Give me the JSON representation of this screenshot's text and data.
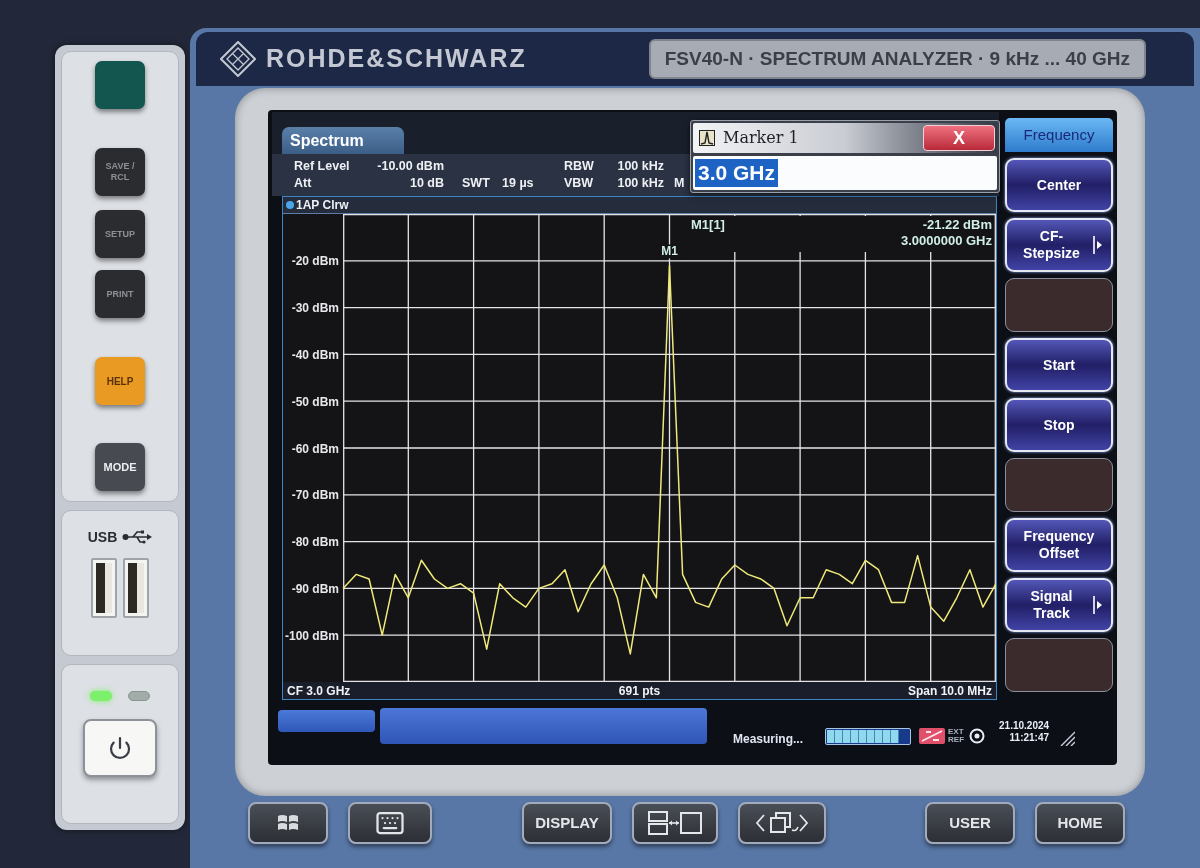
{
  "header": {
    "brand": "ROHDE&SCHWARZ",
    "model": "FSV40-N · SPECTRUM ANALYZER · 9 kHz ... 40 GHz"
  },
  "side_keys": [
    {
      "color": "#12564f"
    },
    {
      "label": "SAVE / RCL",
      "color": "#2a2c30"
    },
    {
      "label": "SETUP",
      "color": "#2a2c30"
    },
    {
      "label": "PRINT",
      "color": "#2a2c30"
    },
    {
      "label": "HELP",
      "color": "#e89a22"
    },
    {
      "label": "MODE",
      "color": "#474a50"
    }
  ],
  "usb": {
    "label": "USB"
  },
  "power": {
    "leds": [
      {
        "on": true
      },
      {
        "on": false
      }
    ]
  },
  "screen": {
    "tabs": [
      {
        "label": "Spectrum",
        "selected": true
      }
    ],
    "settings_columns": [
      {
        "entries": [
          {
            "label": "Ref Level",
            "value": "-10.00 dBm"
          },
          {
            "label": "Att",
            "value": "10 dB"
          }
        ]
      },
      {
        "entries": [
          {
            "label": "SWT",
            "value": "19 µs"
          }
        ]
      },
      {
        "entries": [
          {
            "label": "RBW",
            "value": "100 kHz"
          },
          {
            "label": "VBW",
            "value": "100 kHz"
          }
        ]
      },
      {
        "entries": [
          {
            "label": "M"
          }
        ]
      }
    ],
    "dialog": {
      "title": "Marker 1",
      "close": "X",
      "value": "3.0 GHz"
    },
    "chart_data": {
      "type": "line",
      "grid": true,
      "categories": [
        null,
        null,
        null,
        null,
        null,
        null,
        null,
        null,
        null,
        null,
        null,
        null,
        null,
        null,
        null,
        null,
        null,
        null,
        null,
        null,
        null,
        null,
        null,
        null,
        null,
        null,
        null,
        null,
        null,
        null,
        null,
        null,
        null,
        null,
        null,
        null,
        null,
        null,
        null,
        null,
        null,
        null,
        null,
        null,
        null,
        null,
        null,
        null,
        null,
        null,
        null
      ],
      "ylim": [
        -110,
        -10
      ],
      "yticks": [
        {
          "value": -20,
          "label": "-20 dBm"
        },
        {
          "value": -30,
          "label": "-30 dBm"
        },
        {
          "value": -40,
          "label": "-40 dBm"
        },
        {
          "value": -50,
          "label": "-50 dBm"
        },
        {
          "value": -60,
          "label": "-60 dBm"
        },
        {
          "value": -70,
          "label": "-70 dBm"
        },
        {
          "value": -80,
          "label": "-80 dBm"
        },
        {
          "value": -90,
          "label": "-90 dBm"
        },
        {
          "value": -100,
          "label": "-100 dBm"
        }
      ],
      "series": [
        {
          "name": "1AP Clrw",
          "color": "#efe97a",
          "values": [
            -90,
            -87,
            -88,
            -100,
            -87,
            -92,
            -84,
            -88,
            -90,
            -89,
            -91,
            -103,
            -89,
            -92,
            -94,
            -90,
            -89,
            -86,
            -95,
            -89,
            -85,
            -92,
            -104,
            -87,
            -92,
            -21,
            -87,
            -93,
            -94,
            -88,
            -85,
            -87,
            -88,
            -90,
            -98,
            -92,
            -92,
            -86,
            -87,
            -89,
            -84,
            -86,
            -93,
            -93,
            -83,
            -94,
            -97,
            -92,
            -86,
            -94,
            -89
          ]
        }
      ],
      "annotations": [
        {
          "text": "M1"
        }
      ]
    },
    "marker_readout": {
      "name": "M1[1]",
      "power": "-21.22 dBm",
      "frequency": "3.0000000 GHz"
    },
    "footer": {
      "center_frequency": "CF 3.0 GHz",
      "points": "691 pts",
      "span": "Span 10.0 MHz"
    },
    "status": {
      "message": "Measuring...",
      "progress": {
        "level": 0.88
      },
      "ext_ref": "EXT REF",
      "date": "21.10.2024",
      "time": "11:21:47"
    },
    "softkeys": {
      "title": "Frequency",
      "keys": [
        {
          "kind": "key",
          "label": "Center",
          "submenu": false
        },
        {
          "kind": "key",
          "label": "CF-Stepsize",
          "submenu": true
        },
        {
          "kind": "blank"
        },
        {
          "kind": "key",
          "label": "Start",
          "submenu": false
        },
        {
          "kind": "key",
          "label": "Stop",
          "submenu": false
        },
        {
          "kind": "blank"
        },
        {
          "kind": "key",
          "label": "Frequency Offset",
          "submenu": false
        },
        {
          "kind": "key",
          "label": "Signal Track",
          "submenu": true
        },
        {
          "kind": "blank"
        }
      ]
    }
  },
  "front_key_groups": [
    {
      "keys": [
        {
          "kind": "windows"
        },
        {
          "kind": "keyboard"
        }
      ]
    },
    {
      "keys": [
        {
          "kind": "text",
          "label": "DISPLAY"
        },
        {
          "kind": "split"
        },
        {
          "kind": "swap"
        }
      ]
    },
    {
      "keys": [
        {
          "kind": "text",
          "label": "USER"
        },
        {
          "kind": "text",
          "label": "HOME"
        }
      ]
    }
  ]
}
